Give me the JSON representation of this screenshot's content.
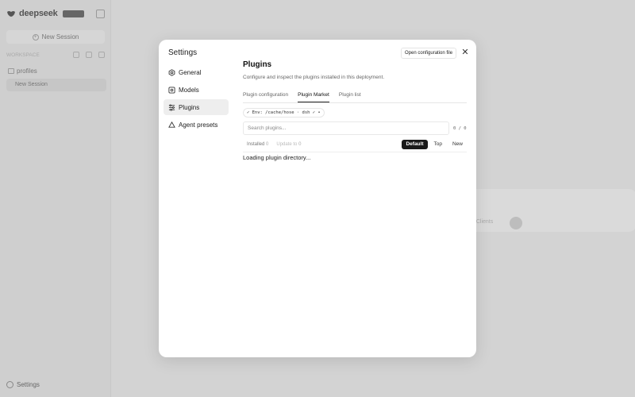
{
  "app": {
    "logo_text": "deepseek",
    "logo_badge": "",
    "new_session_label": "New Session",
    "workspace_label": "WORKSPACE",
    "project_name": "profiles",
    "session_item": "New Session",
    "settings_label": "Settings"
  },
  "modal": {
    "title": "Settings",
    "open_config_label": "Open configuration file",
    "close_glyph": "✕",
    "nav": [
      {
        "label": "General",
        "icon": "gear-icon"
      },
      {
        "label": "Models",
        "icon": "cube-icon"
      },
      {
        "label": "Plugins",
        "icon": "sliders-icon"
      },
      {
        "label": "Agent presets",
        "icon": "recycle-icon"
      }
    ],
    "content": {
      "title": "Plugins",
      "description": "Configure and inspect the plugins installed in this deployment.",
      "tabs": [
        "Plugin configuration",
        "Plugin Market",
        "Plugin list"
      ],
      "env_badge": "✓ Env: /cache/hose · dsh ✓ •",
      "search_placeholder": "Search plugins...",
      "counter": "0 / 0",
      "filter_installed": "Installed",
      "filter_installed_count": "0",
      "filter_update": "Update to",
      "filter_update_count": "0",
      "sort_options": [
        "Default",
        "Top",
        "New"
      ],
      "loading_text": "Loading plugin directory..."
    }
  },
  "background": {
    "ghost_pill": "0 Clients"
  },
  "colors": {
    "overlay_bg": "#d3d3d3",
    "modal_bg": "#ffffff",
    "active_sort_bg": "#1a1a1a"
  }
}
